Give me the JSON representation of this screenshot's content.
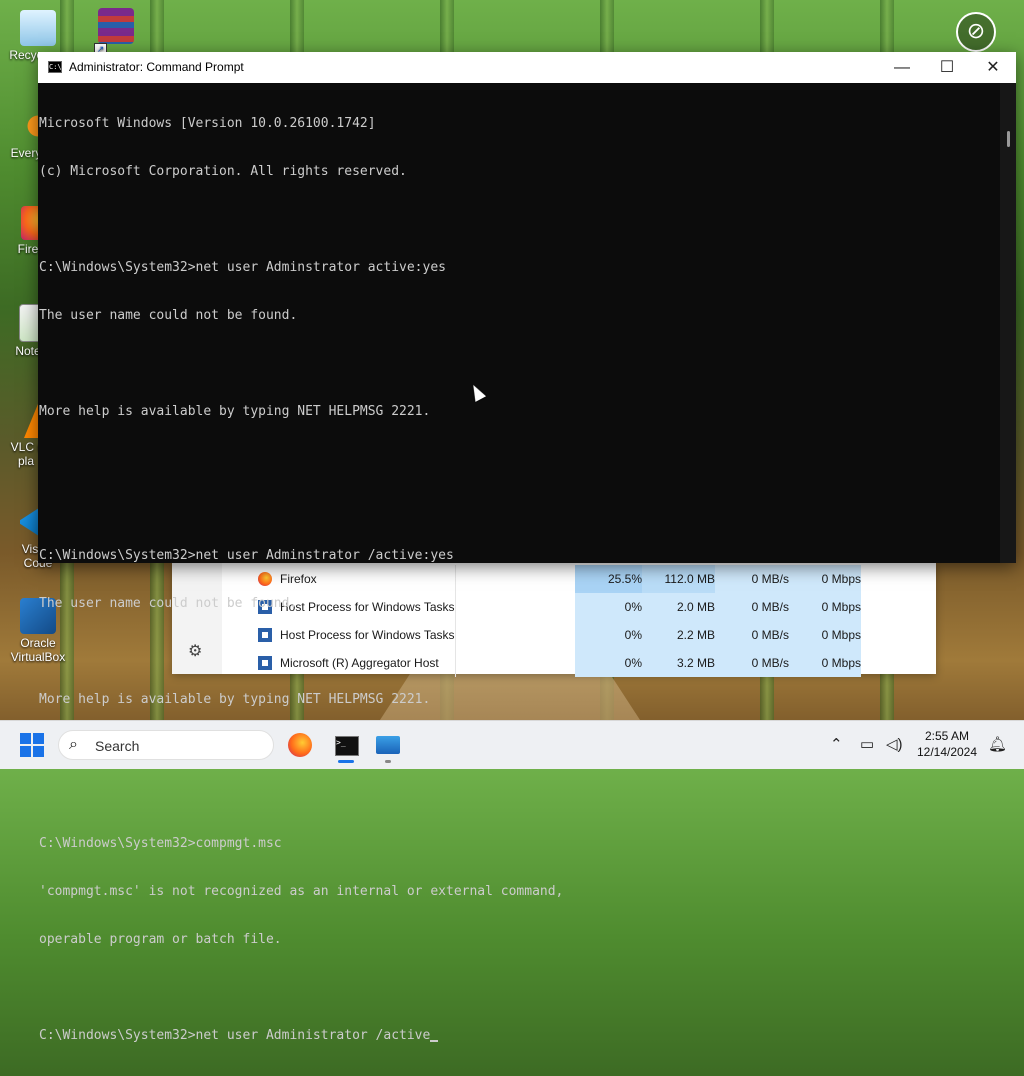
{
  "desktop": {
    "icons": [
      {
        "label": "Recycle Bin",
        "shown": "Recyc",
        "name": "recycle-bin"
      },
      {
        "label": "WinRAR",
        "shown": "",
        "name": "winrar"
      },
      {
        "label": "Everything",
        "shown": "Every",
        "name": "everything"
      },
      {
        "label": "Firefox",
        "shown": "Fire",
        "name": "firefox"
      },
      {
        "label": "Notepad",
        "shown": "Note",
        "name": "notepad"
      },
      {
        "label": "VLC media player",
        "shown": "VLC r\npla",
        "name": "vlc"
      },
      {
        "label": "Visual Studio Code",
        "shown": "Visual\nCode",
        "name": "vscode"
      },
      {
        "label": "Oracle VirtualBox",
        "shown": "Oracle\nVirtualBox",
        "name": "virtualbox"
      }
    ]
  },
  "cmd": {
    "title": "Administrator: Command Prompt",
    "lines": [
      "Microsoft Windows [Version 10.0.26100.1742]",
      "(c) Microsoft Corporation. All rights reserved.",
      "",
      "C:\\Windows\\System32>net user Adminstrator active:yes",
      "The user name could not be found.",
      "",
      "More help is available by typing NET HELPMSG 2221.",
      "",
      "",
      "C:\\Windows\\System32>net user Adminstrator /active:yes",
      "The user name could not be found.",
      "",
      "More help is available by typing NET HELPMSG 2221.",
      "",
      "",
      "C:\\Windows\\System32>compmgt.msc",
      "'compmgt.msc' is not recognized as an internal or external command,",
      "operable program or batch file.",
      "",
      "C:\\Windows\\System32>net user Administrator /active"
    ],
    "minimize": "—",
    "maximize": "☐",
    "close": "✕"
  },
  "taskmanager": {
    "rows": [
      {
        "name": "Firefox",
        "cpu": "25.5%",
        "memory": "112.0 MB",
        "disk": "0 MB/s",
        "network": "0 Mbps",
        "icon": "firefox-icon"
      },
      {
        "name": "Host Process for Windows Tasks",
        "cpu": "0%",
        "memory": "2.0 MB",
        "disk": "0 MB/s",
        "network": "0 Mbps",
        "icon": "process-icon"
      },
      {
        "name": "Host Process for Windows Tasks",
        "cpu": "0%",
        "memory": "2.2 MB",
        "disk": "0 MB/s",
        "network": "0 Mbps",
        "icon": "process-icon"
      },
      {
        "name": "Microsoft (R) Aggregator Host",
        "cpu": "0%",
        "memory": "3.2 MB",
        "disk": "0 MB/s",
        "network": "0 Mbps",
        "icon": "process-icon"
      }
    ]
  },
  "taskbar": {
    "search_placeholder": "Search",
    "time": "2:55 AM",
    "date": "12/14/2024"
  },
  "colors": {
    "accent": "#1a73e8",
    "console_bg": "#0c0c0c",
    "console_fg": "#cccccc",
    "cpu_highlight": "#cfe8fb"
  }
}
